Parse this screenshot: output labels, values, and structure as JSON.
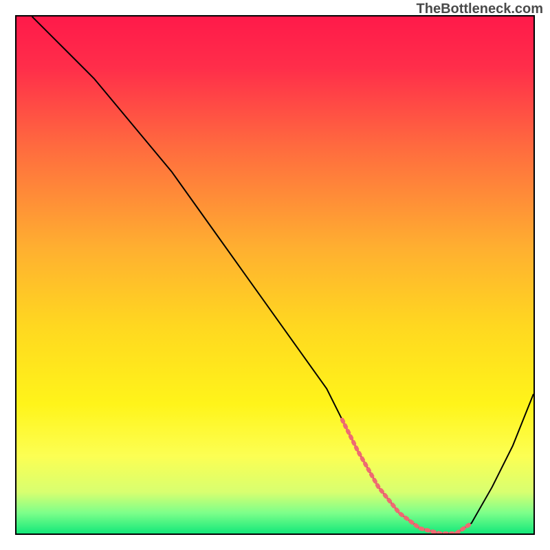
{
  "watermark": "TheBottleneck.com",
  "chart_data": {
    "type": "line",
    "title": "",
    "xlabel": "",
    "ylabel": "",
    "xlim": [
      0,
      100
    ],
    "ylim": [
      0,
      100
    ],
    "grid": false,
    "legend": false,
    "gradient_stops": [
      {
        "offset": 0,
        "color": "#ff1a4a"
      },
      {
        "offset": 0.1,
        "color": "#ff2e4a"
      },
      {
        "offset": 0.25,
        "color": "#ff6a3f"
      },
      {
        "offset": 0.45,
        "color": "#ffb030"
      },
      {
        "offset": 0.6,
        "color": "#ffd820"
      },
      {
        "offset": 0.75,
        "color": "#fff41a"
      },
      {
        "offset": 0.85,
        "color": "#fcff53"
      },
      {
        "offset": 0.92,
        "color": "#d8ff70"
      },
      {
        "offset": 0.96,
        "color": "#7dff8a"
      },
      {
        "offset": 1.0,
        "color": "#14e87a"
      }
    ],
    "series": [
      {
        "name": "bottleneck-curve",
        "color": "#000000",
        "width": 2,
        "x": [
          3,
          6,
          10,
          15,
          20,
          25,
          30,
          35,
          40,
          45,
          50,
          55,
          60,
          63,
          66,
          70,
          74,
          78,
          82,
          85,
          88,
          92,
          96,
          100
        ],
        "y": [
          100,
          97,
          93,
          88,
          82,
          76,
          70,
          63,
          56,
          49,
          42,
          35,
          28,
          22,
          16,
          9,
          4,
          1,
          0,
          0,
          2,
          9,
          17,
          27
        ]
      },
      {
        "name": "optimal-range-marker",
        "color": "#ef6a72",
        "width": 6,
        "dash": "3,6",
        "x": [
          63,
          66,
          70,
          74,
          78,
          82,
          85,
          88
        ],
        "y": [
          22,
          16,
          9,
          4,
          1,
          0,
          0,
          2
        ]
      }
    ]
  }
}
